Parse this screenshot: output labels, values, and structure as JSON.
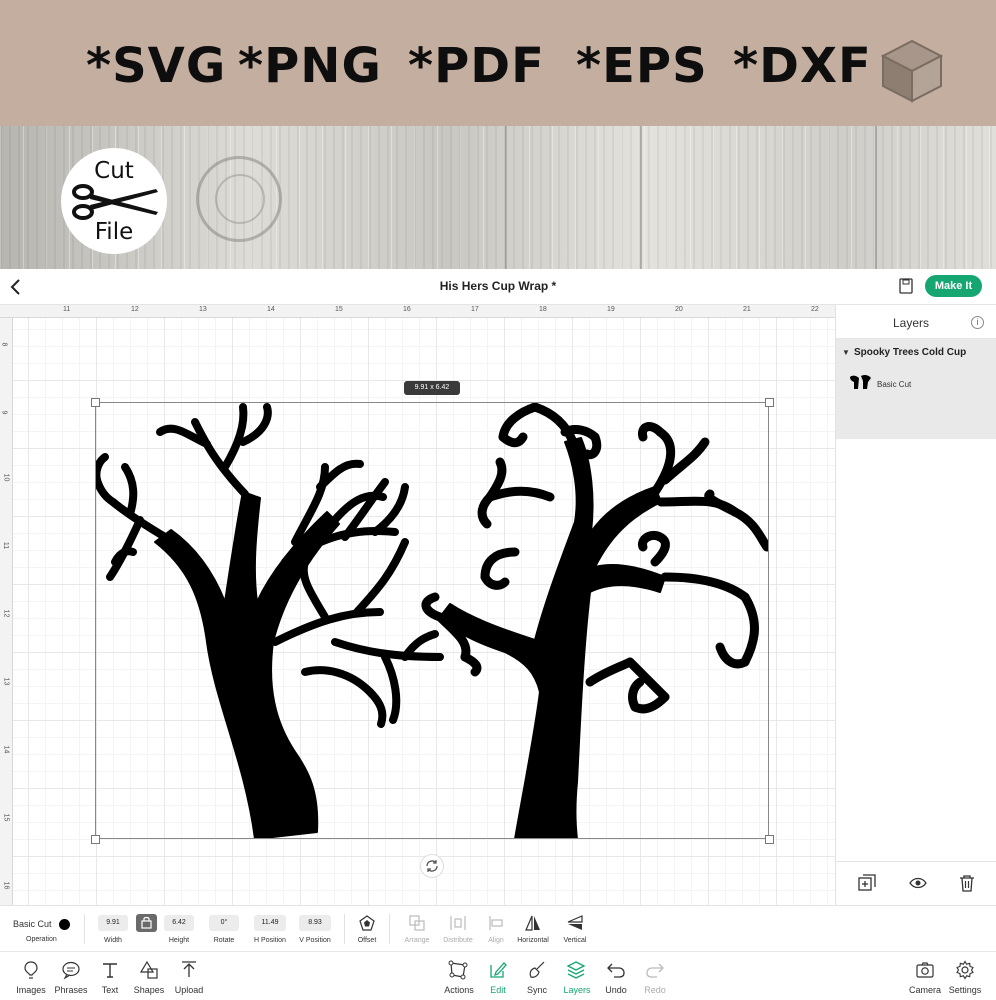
{
  "banner": {
    "formats": [
      "*SVG",
      "*PNG",
      "*PDF",
      "*EPS",
      "*DXF"
    ],
    "cube_icon": "cube-icon"
  },
  "badge": {
    "line1": "Cut",
    "line2": "File",
    "icon": "scissors-icon"
  },
  "app": {
    "title": "His Hers Cup Wrap *",
    "make_it": "Make It",
    "icons": {
      "back": "chevron-left-icon",
      "save": "save-icon"
    }
  },
  "ruler": {
    "top_ticks": [
      "11",
      "12",
      "13",
      "14",
      "15",
      "16",
      "17",
      "18",
      "19",
      "20",
      "21",
      "22"
    ],
    "left_ticks": [
      "8",
      "9",
      "10",
      "11",
      "12",
      "13",
      "14",
      "15",
      "16"
    ]
  },
  "selection": {
    "dimensions": "9.91 x 6.42"
  },
  "layers": {
    "title": "Layers",
    "group_name": "Spooky Trees Cold Cup",
    "layer_name": "Basic Cut",
    "footer_icons": [
      "duplicate-icon",
      "eye-icon",
      "trash-icon"
    ]
  },
  "edit": {
    "operation_value": "Basic Cut",
    "operation_label": "Operation",
    "width": "9.91",
    "width_label": "Width",
    "height": "6.42",
    "height_label": "Height",
    "rotate": "0°",
    "rotate_label": "Rotate",
    "hpos": "11.49",
    "hpos_label": "H Position",
    "vpos": "8.93",
    "vpos_label": "V Position",
    "offset": "Offset",
    "arrange": "Arrange",
    "distribute": "Distribute",
    "align": "Align",
    "horizontal": "Horizontal",
    "vertical": "Vertical"
  },
  "bottom": {
    "images": "Images",
    "phrases": "Phrases",
    "text": "Text",
    "shapes": "Shapes",
    "upload": "Upload",
    "actions": "Actions",
    "edit": "Edit",
    "sync": "Sync",
    "layers": "Layers",
    "undo": "Undo",
    "redo": "Redo",
    "camera": "Camera",
    "settings": "Settings"
  },
  "colors": {
    "accent": "#15a672",
    "banner": "#c4ae9f"
  }
}
